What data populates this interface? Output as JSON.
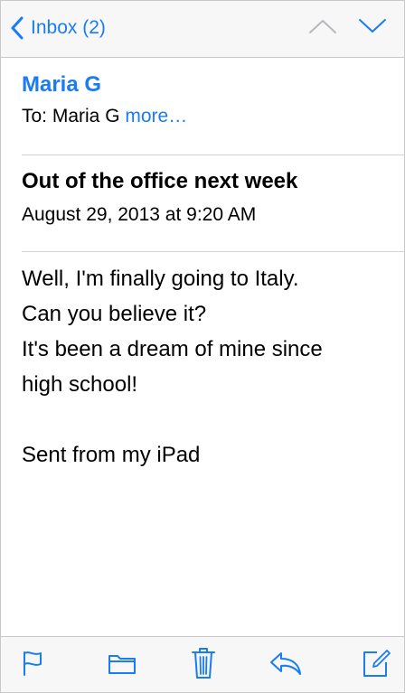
{
  "nav": {
    "back_label": "Inbox (2)",
    "back_icon": "chevron-left-icon",
    "up_icon": "chevron-up-icon",
    "down_icon": "chevron-down-icon",
    "up_enabled": false,
    "down_enabled": true
  },
  "header": {
    "sender": "Maria G",
    "to_prefix": "To: Maria G",
    "more_label": "more…"
  },
  "message": {
    "subject": "Out of the office next week",
    "date": "August 29, 2013 at 9:20 AM",
    "body_lines": [
      "Well, I'm finally going to Italy.",
      "Can you believe it?",
      "It's been a dream of mine since",
      "high school!"
    ],
    "signature": "Sent from my iPad"
  },
  "toolbar": {
    "items": [
      {
        "icon": "flag-icon"
      },
      {
        "icon": "folder-icon"
      },
      {
        "icon": "trash-icon"
      },
      {
        "icon": "reply-icon"
      },
      {
        "icon": "compose-icon"
      }
    ]
  },
  "colors": {
    "accent": "#1a7cf4",
    "disabled": "#b8b8bd",
    "bar_background": "#f7f7f8",
    "separator": "#c8c8cc",
    "text": "#000000"
  }
}
